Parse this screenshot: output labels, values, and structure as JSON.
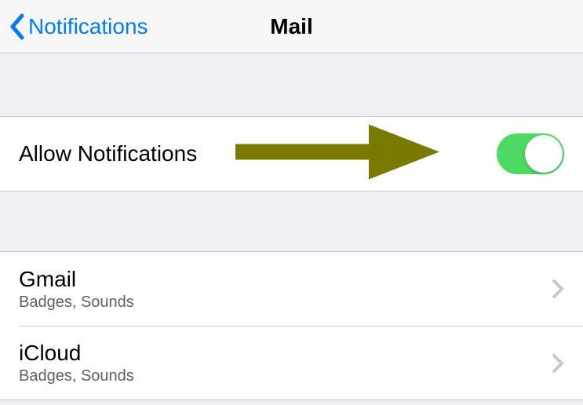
{
  "navbar": {
    "back_label": "Notifications",
    "title": "Mail"
  },
  "allow_notifications": {
    "label": "Allow Notifications",
    "enabled": true
  },
  "accounts": [
    {
      "name": "Gmail",
      "detail": "Badges, Sounds"
    },
    {
      "name": "iCloud",
      "detail": "Badges, Sounds"
    }
  ],
  "colors": {
    "tint": "#007aff",
    "toggle_on": "#4cd964",
    "annotation_arrow": "#7a7a00"
  }
}
